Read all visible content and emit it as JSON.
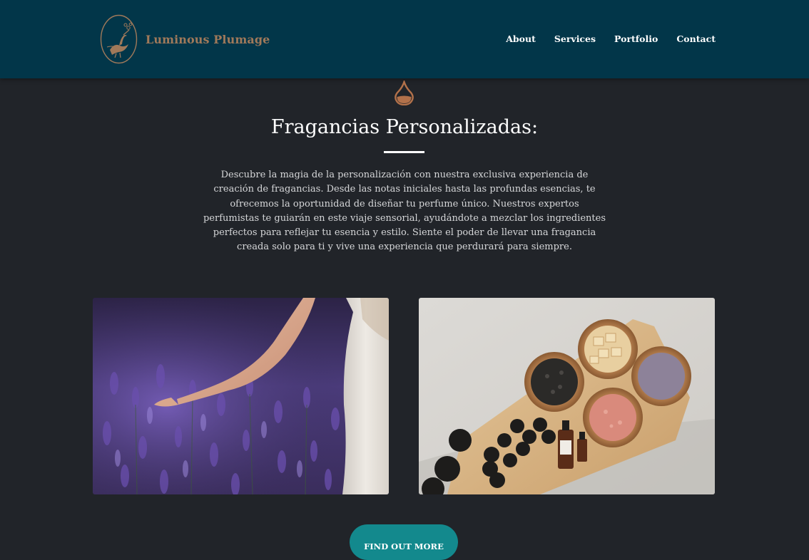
{
  "header": {
    "brand_name": "Luminous Plumage",
    "nav": [
      "About",
      "Services",
      "Portfolio",
      "Contact"
    ]
  },
  "section": {
    "title": "Fragancias Personalizadas:",
    "description": "Descubre la magia de la personalización con nuestra exclusiva experiencia de creación de fragancias. Desde las notas iniciales hasta las profundas esencias, te ofrecemos la oportunidad de diseñar tu perfume único. Nuestros expertos perfumistas te guiarán en este viaje sensorial, ayudándote a mezclar los ingredientes perfectos para reflejar tu esencia y estilo. Siente el poder de llevar una fragancia creada solo para ti y vive una experiencia que perdurará para siempre.",
    "cta_label": "FIND OUT MORE"
  },
  "icons": {
    "logo": "bird-logo-icon",
    "section": "perfume-drop-icon"
  },
  "colors": {
    "header_bg": "#023649",
    "page_bg": "#212429",
    "brand_text": "#a0795a",
    "accent_copper": "#b2714a",
    "button_teal": "#13898d"
  }
}
